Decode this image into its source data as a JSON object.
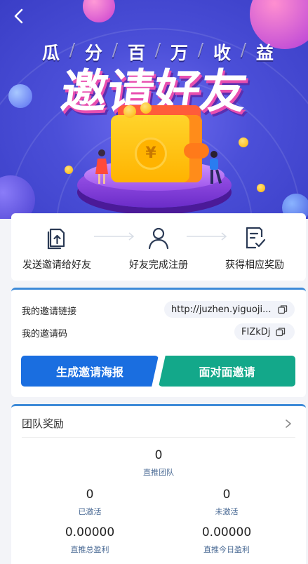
{
  "hero": {
    "subtitle_chars": [
      "瓜",
      "分",
      "百",
      "万",
      "收",
      "益"
    ],
    "title": "邀请好友",
    "coin_symbol": "¥"
  },
  "steps": [
    {
      "label": "发送邀请给好友",
      "icon": "share-document-icon"
    },
    {
      "label": "好友完成注册",
      "icon": "user-icon"
    },
    {
      "label": "获得相应奖励",
      "icon": "checklist-icon"
    }
  ],
  "invite": {
    "link_label": "我的邀请链接",
    "link_value": "http://juzhen.yiguoji...",
    "code_label": "我的邀请码",
    "code_value": "FIZkDj",
    "poster_button": "生成邀请海报",
    "face_button": "面对面邀请"
  },
  "team": {
    "title": "团队奖励",
    "direct_team": {
      "value": "0",
      "label": "直推团队"
    },
    "activated": {
      "value": "0",
      "label": "已激活"
    },
    "not_activated": {
      "value": "0",
      "label": "未激活"
    },
    "total_profit": {
      "value": "0.00000",
      "label": "直推总盈利"
    },
    "today_profit": {
      "value": "0.00000",
      "label": "直推今日盈利"
    }
  },
  "colors": {
    "primary_blue": "#1a6ee0",
    "teal": "#13a88a",
    "hero_purple": "#4b4fd8",
    "label_blue": "#4a6a94"
  }
}
